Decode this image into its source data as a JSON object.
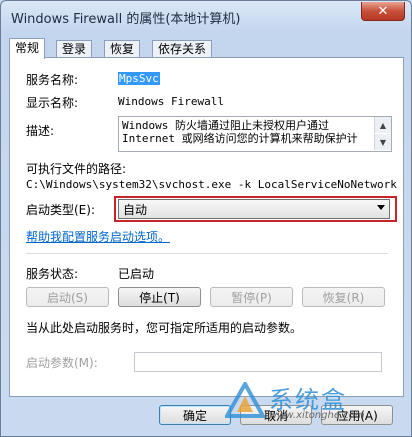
{
  "window": {
    "title": "Windows Firewall 的属性(本地计算机)",
    "close_glyph": "✕"
  },
  "tabs": [
    {
      "label": "常规",
      "active": true
    },
    {
      "label": "登录",
      "active": false
    },
    {
      "label": "恢复",
      "active": false
    },
    {
      "label": "依存关系",
      "active": false
    }
  ],
  "general": {
    "service_name_label": "服务名称:",
    "service_name_value": "MpsSvc",
    "display_name_label": "显示名称:",
    "display_name_value": "Windows Firewall",
    "description_label": "描述:",
    "description_value": "Windows 防火墙通过阻止未授权用户通过 Internet 或网络访问您的计算机来帮助保护计",
    "exe_path_label": "可执行文件的路径:",
    "exe_path_value": "C:\\Windows\\system32\\svchost.exe -k LocalServiceNoNetwork",
    "startup_type_label": "启动类型(E):",
    "startup_type_value": "自动",
    "help_link": "帮助我配置服务启动选项。",
    "status_label": "服务状态:",
    "status_value": "已启动",
    "start_label": "启动(S)",
    "stop_label": "停止(T)",
    "pause_label": "暂停(P)",
    "resume_label": "恢复(R)",
    "start_params_hint": "当从此处启动服务时，您可指定所适用的启动参数。",
    "start_params_label": "启动参数(M):",
    "start_params_value": ""
  },
  "footer": {
    "ok_label": "确定",
    "cancel_label": "取消",
    "apply_label": "应用(A)"
  },
  "watermark": {
    "text": "系统盒",
    "url": "www.xitonghe.com"
  }
}
